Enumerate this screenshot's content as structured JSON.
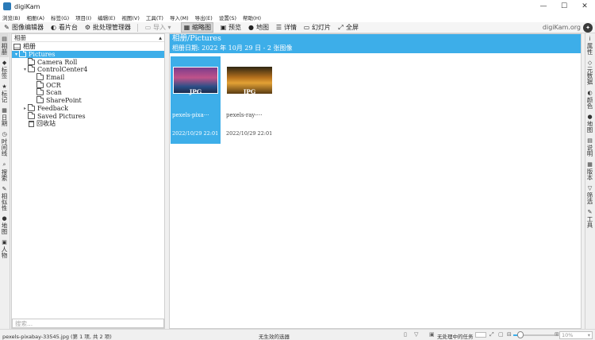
{
  "window": {
    "title": "digiKam",
    "controls": {
      "minimize": "—",
      "maximize": "☐",
      "close": "✕"
    }
  },
  "menubar": {
    "items": [
      "浏览(B)",
      "相册(A)",
      "标签(G)",
      "项目(I)",
      "编辑(E)",
      "视图(V)",
      "工具(T)",
      "导入(M)",
      "导出(E)",
      "设置(S)",
      "帮助(H)"
    ]
  },
  "toolbar": {
    "image_editor": "图像编辑器",
    "light_table": "看片台",
    "batch_queue": "批处理管理器",
    "import": "导入",
    "thumbnails": "缩略图",
    "preview": "预览",
    "map": "地图",
    "details": "详情",
    "slideshow": "幻灯片",
    "fullscreen": "全屏",
    "brand": "digiKam.org"
  },
  "left_tabs": [
    {
      "label": "相册",
      "icon": "album-icon"
    },
    {
      "label": "标签",
      "icon": "tag-icon"
    },
    {
      "label": "标记",
      "icon": "label-icon"
    },
    {
      "label": "日期",
      "icon": "calendar-icon"
    },
    {
      "label": "时间线",
      "icon": "timeline-icon"
    },
    {
      "label": "搜索",
      "icon": "search-icon"
    },
    {
      "label": "相似性",
      "icon": "similarity-icon"
    },
    {
      "label": "地图",
      "icon": "map-icon"
    },
    {
      "label": "人物",
      "icon": "people-icon"
    }
  ],
  "right_tabs": [
    {
      "label": "属性",
      "icon": "info-icon"
    },
    {
      "label": "元数据",
      "icon": "metadata-icon"
    },
    {
      "label": "颜色",
      "icon": "color-icon"
    },
    {
      "label": "地图",
      "icon": "map-icon"
    },
    {
      "label": "说明",
      "icon": "caption-icon"
    },
    {
      "label": "版本",
      "icon": "versions-icon"
    },
    {
      "label": "筛选",
      "icon": "filter-icon"
    },
    {
      "label": "工具",
      "icon": "tools-icon"
    }
  ],
  "album_panel": {
    "header": "相册",
    "root": "相册",
    "tree": [
      {
        "label": "Pictures",
        "level": 0,
        "expander": "▾",
        "selected": true
      },
      {
        "label": "Camera Roll",
        "level": 1,
        "expander": ""
      },
      {
        "label": "ControlCenter4",
        "level": 1,
        "expander": "▾"
      },
      {
        "label": "Email",
        "level": 2,
        "expander": ""
      },
      {
        "label": "OCR",
        "level": 2,
        "expander": ""
      },
      {
        "label": "Scan",
        "level": 2,
        "expander": ""
      },
      {
        "label": "SharePoint",
        "level": 2,
        "expander": ""
      },
      {
        "label": "Feedback",
        "level": 1,
        "expander": "▸"
      },
      {
        "label": "Saved Pictures",
        "level": 1,
        "expander": ""
      }
    ],
    "trash": "回收站",
    "search_placeholder": "搜索..."
  },
  "main": {
    "title": "相册/Pictures",
    "subtitle": "相册日期: 2022 年 10月 29 日 - 2 张图像",
    "thumbnails": [
      {
        "format": "JPG",
        "name": "pexels-pixa···",
        "date": "2022/10/29 22:01",
        "selected": true
      },
      {
        "format": "JPG",
        "name": "pexels-ray-···",
        "date": "2022/10/29 22:01",
        "selected": false
      }
    ]
  },
  "statusbar": {
    "file": "pexels-pixabay-33545.jpg (第 1 项, 共 2 项)",
    "filter": "无生效的选器",
    "queue": "无处理中的任务",
    "zoom": "10%"
  },
  "colors": {
    "accent": "#3daee9",
    "panel_bg": "#ffffff",
    "chrome_bg": "#f0f0f0"
  }
}
